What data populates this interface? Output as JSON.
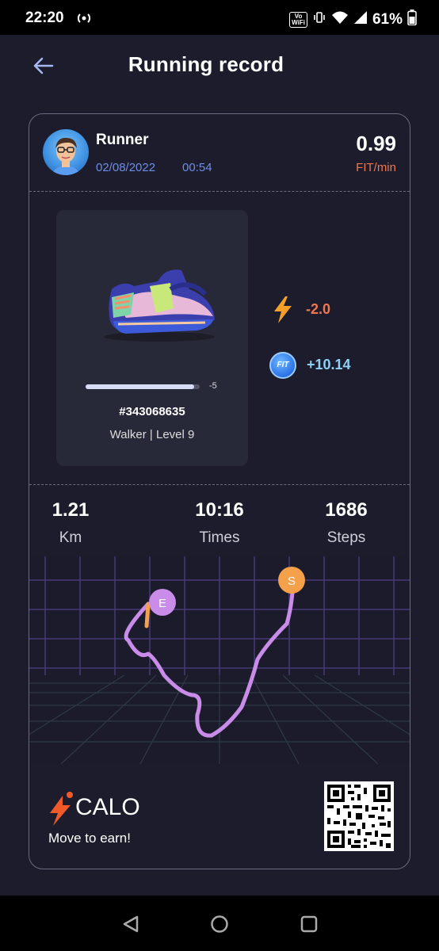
{
  "status_bar": {
    "time": "22:20",
    "battery": "61%",
    "vowifi_top": "Vo",
    "vowifi_bottom": "WiFi"
  },
  "header": {
    "title": "Running record"
  },
  "record": {
    "user_name": "Runner",
    "date": "02/08/2022",
    "time": "00:54",
    "rate_value": "0.99",
    "rate_unit": "FIT/min"
  },
  "sneaker": {
    "progress_fraction": 0.95,
    "progress_label": "-5",
    "id": "#343068635",
    "level": "Walker | Level 9"
  },
  "rewards": {
    "energy": "-2.0",
    "fit_badge": "FIT",
    "fit": "+10.14"
  },
  "stats": [
    {
      "value": "1.21",
      "label": "Km"
    },
    {
      "value": "10:16",
      "label": "Times"
    },
    {
      "value": "1686",
      "label": "Steps"
    }
  ],
  "route": {
    "start_marker": "S",
    "end_marker": "E",
    "start_color": "#f5a04a",
    "end_color": "#c98ce8",
    "path_color": "#c98ce8"
  },
  "footer": {
    "logo_text": "CALO",
    "tagline": "Move to earn!"
  },
  "colors": {
    "accent_orange": "#f07850",
    "date_blue": "#6f8ee6",
    "fit_blue": "#8fd0f5",
    "background": "#1c1c2c"
  }
}
